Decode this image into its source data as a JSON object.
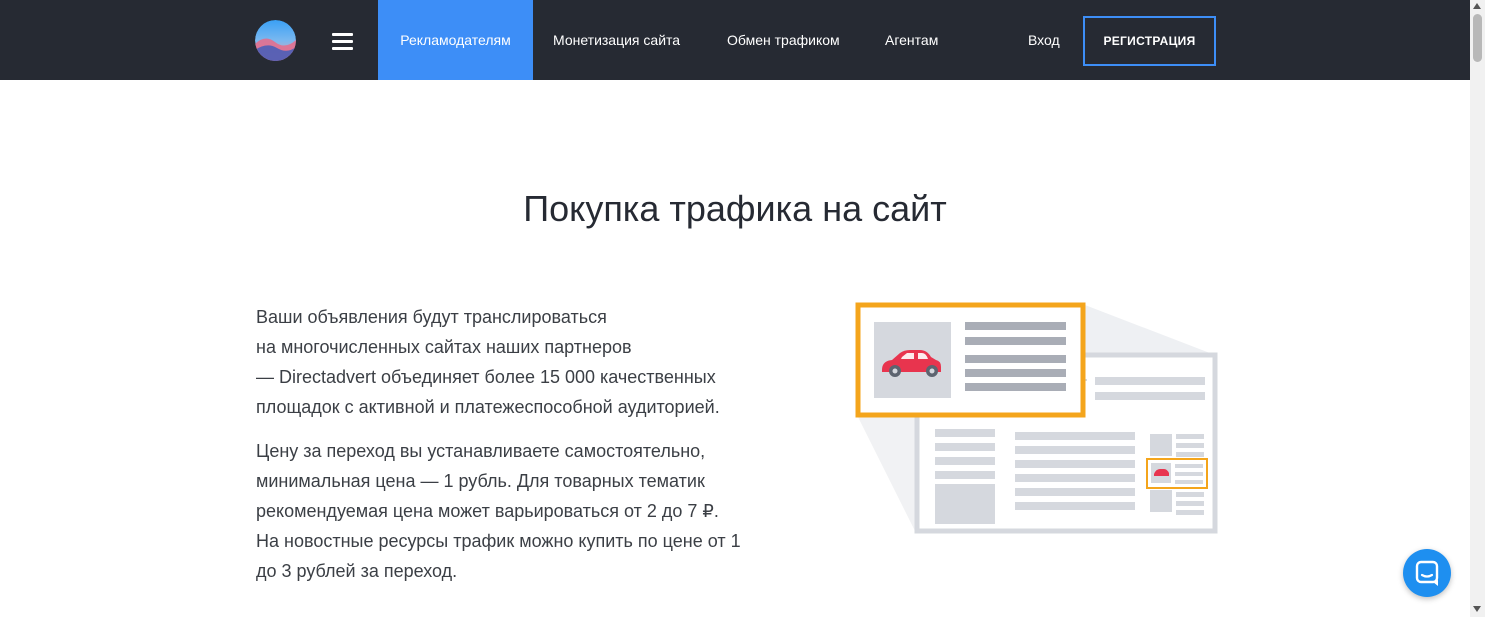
{
  "header": {
    "logo_icon": "gradient-sphere-logo",
    "menu_icon": "hamburger-icon",
    "nav": [
      {
        "label": "Рекламодателям",
        "active": true
      },
      {
        "label": "Монетизация сайта",
        "active": false
      },
      {
        "label": "Обмен трафиком",
        "active": false
      },
      {
        "label": "Агентам",
        "active": false
      }
    ],
    "login_label": "Вход",
    "register_label": "РЕГИСТРАЦИЯ"
  },
  "main": {
    "title": "Покупка трафика на сайт",
    "paragraph1": [
      "Ваши объявления будут транслироваться",
      "на многочисленных сайтах наших партнеров",
      "— Directadvert объединяет более 15 000 качественных",
      "площадок с активной и платежеспособной аудиторией."
    ],
    "paragraph2": [
      "Цену за переход вы устанавливаете самостоятельно,",
      "минимальная цена — 1 рубль. Для товарных тематик",
      "рекомендуемая цена может варьироваться от 2 до 7 ₽.",
      "На новостные ресурсы трафик можно купить по цене от 1",
      "до 3 рублей за переход."
    ],
    "illustration_icon": "ad-placement-illustration"
  },
  "chat": {
    "icon": "chat-icon"
  },
  "colors": {
    "header_bg": "#262a33",
    "accent": "#3d8ef7",
    "highlight": "#f4a51c",
    "car": "#e8344e",
    "chat": "#1e8ff0"
  }
}
